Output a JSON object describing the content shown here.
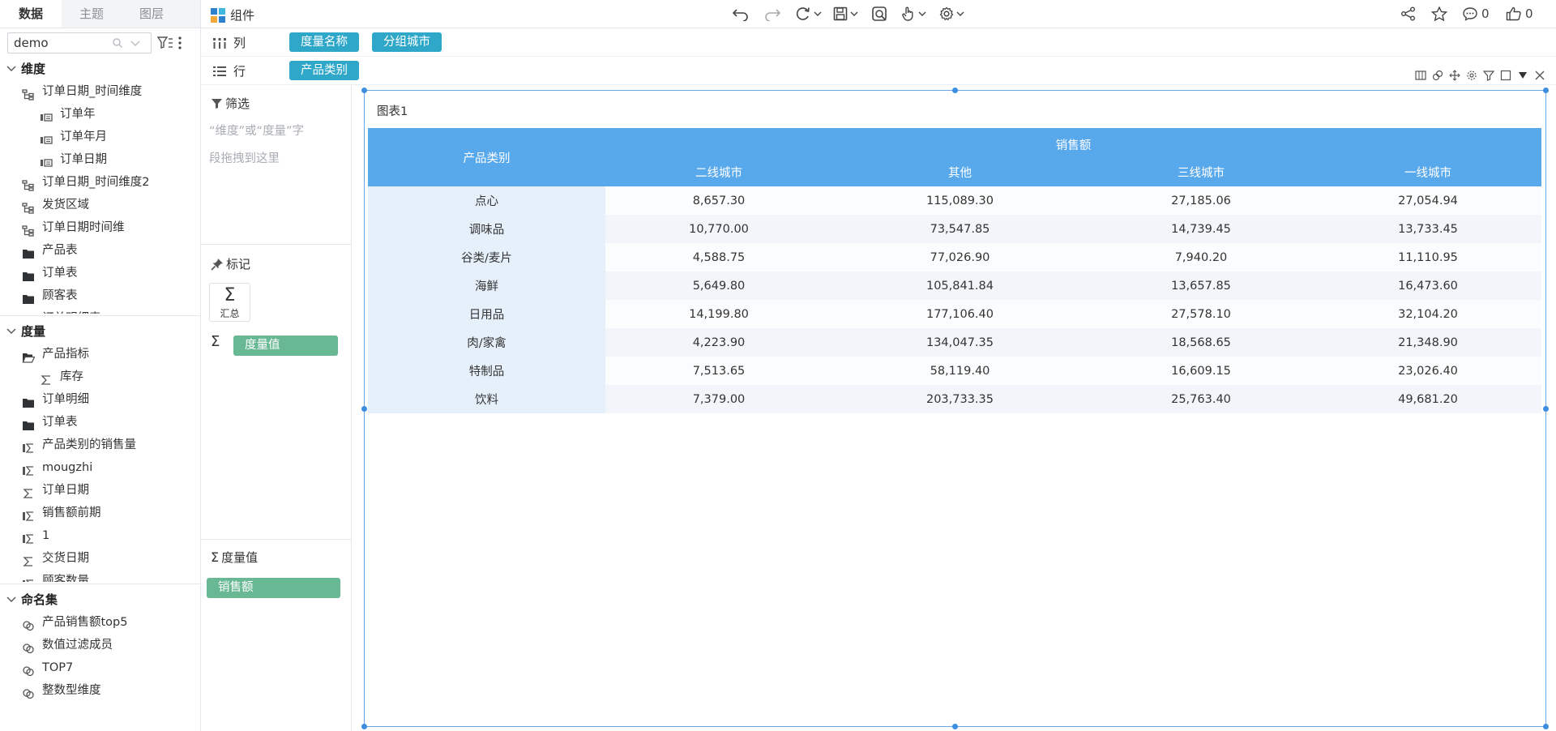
{
  "left_tabs": [
    "数据",
    "主题",
    "图层"
  ],
  "search": {
    "value": "demo"
  },
  "sections": {
    "dimensions": {
      "title": "维度",
      "items": [
        {
          "label": "订单日期_时间维度",
          "icon": "hierarchy-icon",
          "level": 1
        },
        {
          "label": "订单年",
          "icon": "date-level-icon",
          "level": 2
        },
        {
          "label": "订单年月",
          "icon": "date-level-icon",
          "level": 2
        },
        {
          "label": "订单日期",
          "icon": "date-level-icon",
          "level": 2
        },
        {
          "label": "订单日期_时间维度2",
          "icon": "hierarchy-icon",
          "level": 1
        },
        {
          "label": "发货区域",
          "icon": "hierarchy-icon",
          "level": 1
        },
        {
          "label": "订单日期时间维",
          "icon": "hierarchy-icon",
          "level": 1
        },
        {
          "label": "产品表",
          "icon": "folder-icon",
          "level": 1
        },
        {
          "label": "订单表",
          "icon": "folder-icon",
          "level": 1
        },
        {
          "label": "顾客表",
          "icon": "folder-icon",
          "level": 1
        },
        {
          "label": "订单明细表",
          "icon": "folder-icon",
          "level": 1
        }
      ]
    },
    "measures": {
      "title": "度量",
      "items": [
        {
          "label": "产品指标",
          "icon": "folder-open-icon",
          "level": 1
        },
        {
          "label": "库存",
          "icon": "sigma-icon",
          "level": 2
        },
        {
          "label": "订单明细",
          "icon": "folder-icon",
          "level": 1
        },
        {
          "label": "订单表",
          "icon": "folder-icon",
          "level": 1
        },
        {
          "label": "产品类别的销售量",
          "icon": "calc-measure-icon",
          "level": 1
        },
        {
          "label": "mougzhi",
          "icon": "calc-measure-icon",
          "level": 1
        },
        {
          "label": "订单日期",
          "icon": "sigma-icon",
          "level": 1
        },
        {
          "label": "销售额前期",
          "icon": "calc-measure-icon",
          "level": 1
        },
        {
          "label": "1",
          "icon": "calc-measure-icon",
          "level": 1
        },
        {
          "label": "交货日期",
          "icon": "sigma-icon",
          "level": 1
        },
        {
          "label": "顾客数量",
          "icon": "calc-measure-icon",
          "level": 1
        }
      ]
    },
    "named_sets": {
      "title": "命名集",
      "items": [
        {
          "label": "产品销售额top5",
          "icon": "named-set-icon",
          "level": 1
        },
        {
          "label": "数值过滤成员",
          "icon": "named-set-icon",
          "level": 1
        },
        {
          "label": "TOP7",
          "icon": "named-set-icon",
          "level": 1
        },
        {
          "label": "整数型维度",
          "icon": "named-set-icon",
          "level": 1
        }
      ]
    }
  },
  "toolbar": {
    "component_label": "组件",
    "comment_count": "0",
    "like_count": "0"
  },
  "shelves": {
    "columns_label": "列",
    "columns_pills": [
      "度量名称",
      "分组城市"
    ],
    "rows_label": "行",
    "rows_pills": [
      "产品类别"
    ]
  },
  "mid": {
    "filter_title": "筛选",
    "filter_hint_1": "“维度”或“度量”字",
    "filter_hint_2": "段拖拽到这里",
    "marks_title": "标记",
    "sum_label": "汇总",
    "measure_values_pill": "度量值",
    "measure_values_title": "度量值",
    "sales_pill": "销售额"
  },
  "chart_data": {
    "type": "table",
    "title": "图表1",
    "row_header": "产品类别",
    "measure": "销售额",
    "columns": [
      "二线城市",
      "其他",
      "三线城市",
      "一线城市"
    ],
    "rows": [
      {
        "category": "点心",
        "values": [
          "8,657.30",
          "115,089.30",
          "27,185.06",
          "27,054.94"
        ]
      },
      {
        "category": "调味品",
        "values": [
          "10,770.00",
          "73,547.85",
          "14,739.45",
          "13,733.45"
        ]
      },
      {
        "category": "谷类/麦片",
        "values": [
          "4,588.75",
          "77,026.90",
          "7,940.20",
          "11,110.95"
        ]
      },
      {
        "category": "海鲜",
        "values": [
          "5,649.80",
          "105,841.84",
          "13,657.85",
          "16,473.60"
        ]
      },
      {
        "category": "日用品",
        "values": [
          "14,199.80",
          "177,106.40",
          "27,578.10",
          "32,104.20"
        ]
      },
      {
        "category": "肉/家禽",
        "values": [
          "4,223.90",
          "134,047.35",
          "18,568.65",
          "21,348.90"
        ]
      },
      {
        "category": "特制品",
        "values": [
          "7,513.65",
          "58,119.40",
          "16,609.15",
          "23,026.40"
        ]
      },
      {
        "category": "饮料",
        "values": [
          "7,379.00",
          "203,733.35",
          "25,763.40",
          "49,681.20"
        ]
      }
    ]
  },
  "colors": {
    "header_blue": "#58a8ec",
    "pill_blue": "#2ea7c9",
    "pill_green": "#68b894",
    "selection": "#3d8de0"
  }
}
